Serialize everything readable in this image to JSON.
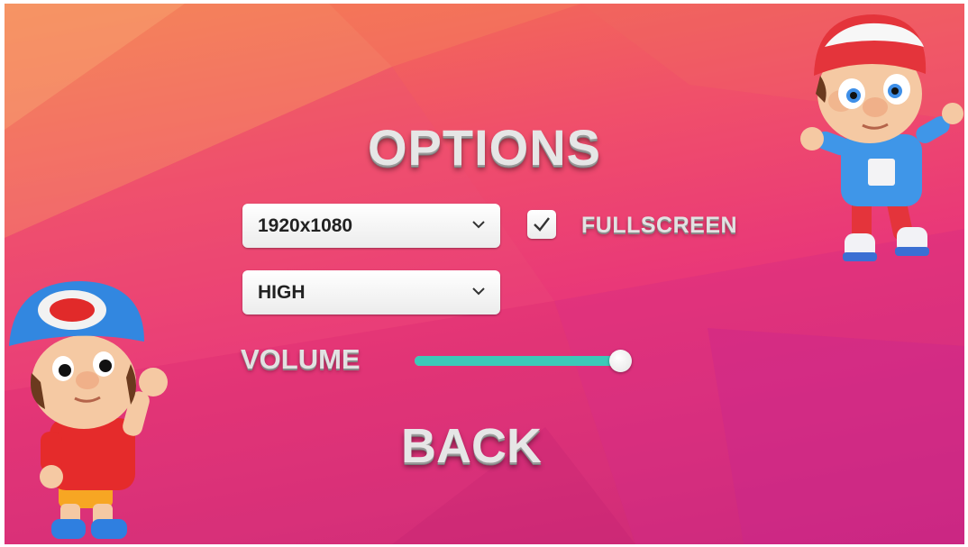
{
  "options_menu": {
    "title": "OPTIONS",
    "resolution_dropdown": {
      "selected": "1920x1080"
    },
    "quality_dropdown": {
      "selected": "HIGH"
    },
    "fullscreen": {
      "label": "FULLSCREEN",
      "checked": true
    },
    "volume": {
      "label": "VOLUME",
      "level": 1.0
    },
    "back_label": "BACK"
  },
  "colors": {
    "background_top": "#f4764f",
    "background_bottom": "#c8287a",
    "slider_fill": "#3cc9b8",
    "text": "#e6e6e6"
  },
  "icons": {
    "dropdown": "chevron-down-icon",
    "checkbox": "checkmark-icon"
  }
}
